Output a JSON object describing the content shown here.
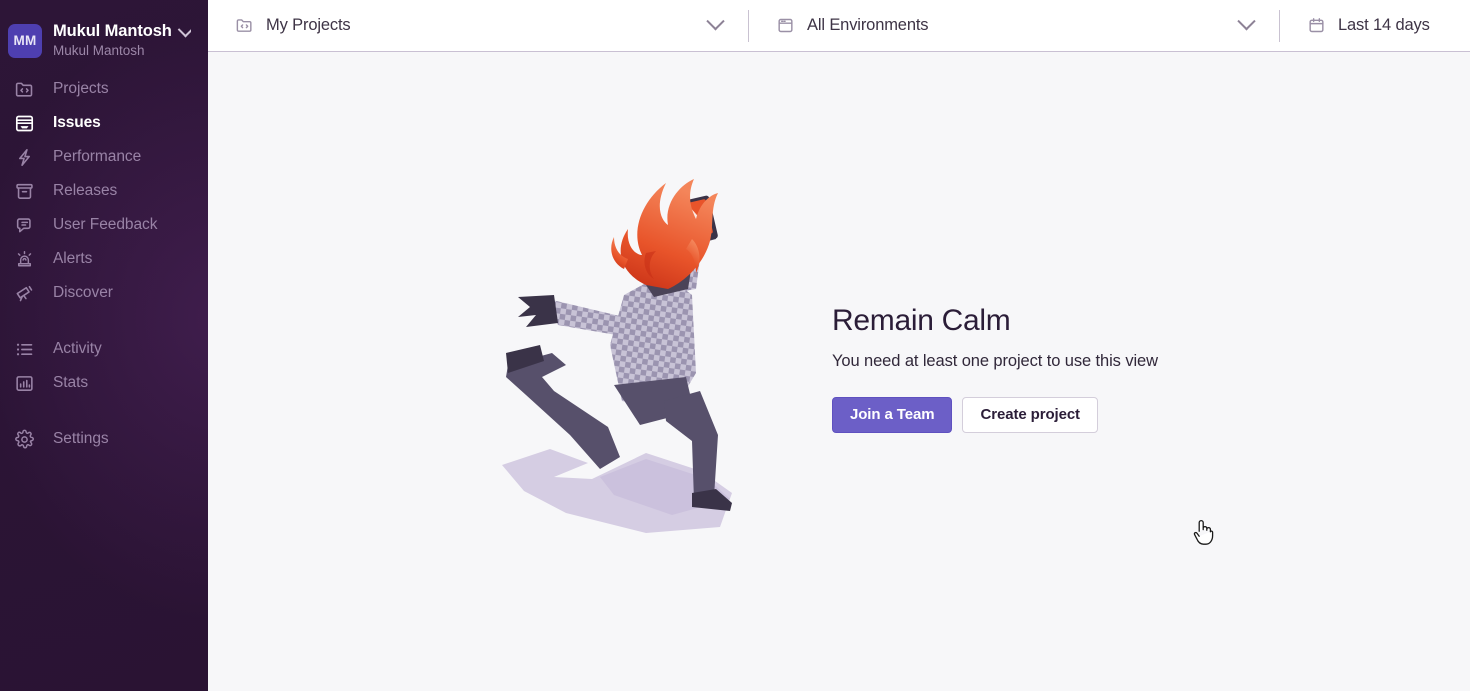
{
  "sidebar": {
    "org": {
      "avatar_initials": "MM",
      "name": "Mukul Mantosh",
      "subtitle": "Mukul Mantosh",
      "chevron_icon": "chevron-down-icon"
    },
    "groups": [
      {
        "items": [
          {
            "label": "Projects",
            "icon": "code-folder-icon",
            "active": false
          },
          {
            "label": "Issues",
            "icon": "issues-drawer-icon",
            "active": true
          },
          {
            "label": "Performance",
            "icon": "lightning-bolt-icon",
            "active": false
          },
          {
            "label": "Releases",
            "icon": "releases-box-icon",
            "active": false
          },
          {
            "label": "User Feedback",
            "icon": "speech-bubble-icon",
            "active": false
          },
          {
            "label": "Alerts",
            "icon": "siren-icon",
            "active": false
          },
          {
            "label": "Discover",
            "icon": "telescope-icon",
            "active": false
          }
        ]
      },
      {
        "items": [
          {
            "label": "Activity",
            "icon": "list-icon",
            "active": false
          },
          {
            "label": "Stats",
            "icon": "bar-chart-icon",
            "active": false
          }
        ]
      },
      {
        "items": [
          {
            "label": "Settings",
            "icon": "gear-icon",
            "active": false
          }
        ]
      }
    ]
  },
  "topbar": {
    "filters": [
      {
        "label": "My Projects",
        "icon": "code-folder-icon",
        "chevron": true
      },
      {
        "label": "All Environments",
        "icon": "window-icon",
        "chevron": true
      },
      {
        "label": "Last 14 days",
        "icon": "calendar-icon",
        "chevron": false
      }
    ]
  },
  "empty_state": {
    "illustration": "running-person-on-fire-illustration",
    "title": "Remain Calm",
    "description": "You need at least one project to use this view",
    "primary_button": "Join a Team",
    "secondary_button": "Create project"
  },
  "cursor": {
    "icon": "pointer-hand-cursor"
  },
  "colors": {
    "sidebar_bg": "#2B1435",
    "content_bg": "#F7F7F9",
    "accent_purple": "#6C5FC7",
    "avatar_bg": "#4E3FB0",
    "text_dark": "#2B1D38",
    "nav_muted": "#9983A6",
    "flame_orange": "#E8542A",
    "shadow_lavender": "#D5CDE3"
  }
}
